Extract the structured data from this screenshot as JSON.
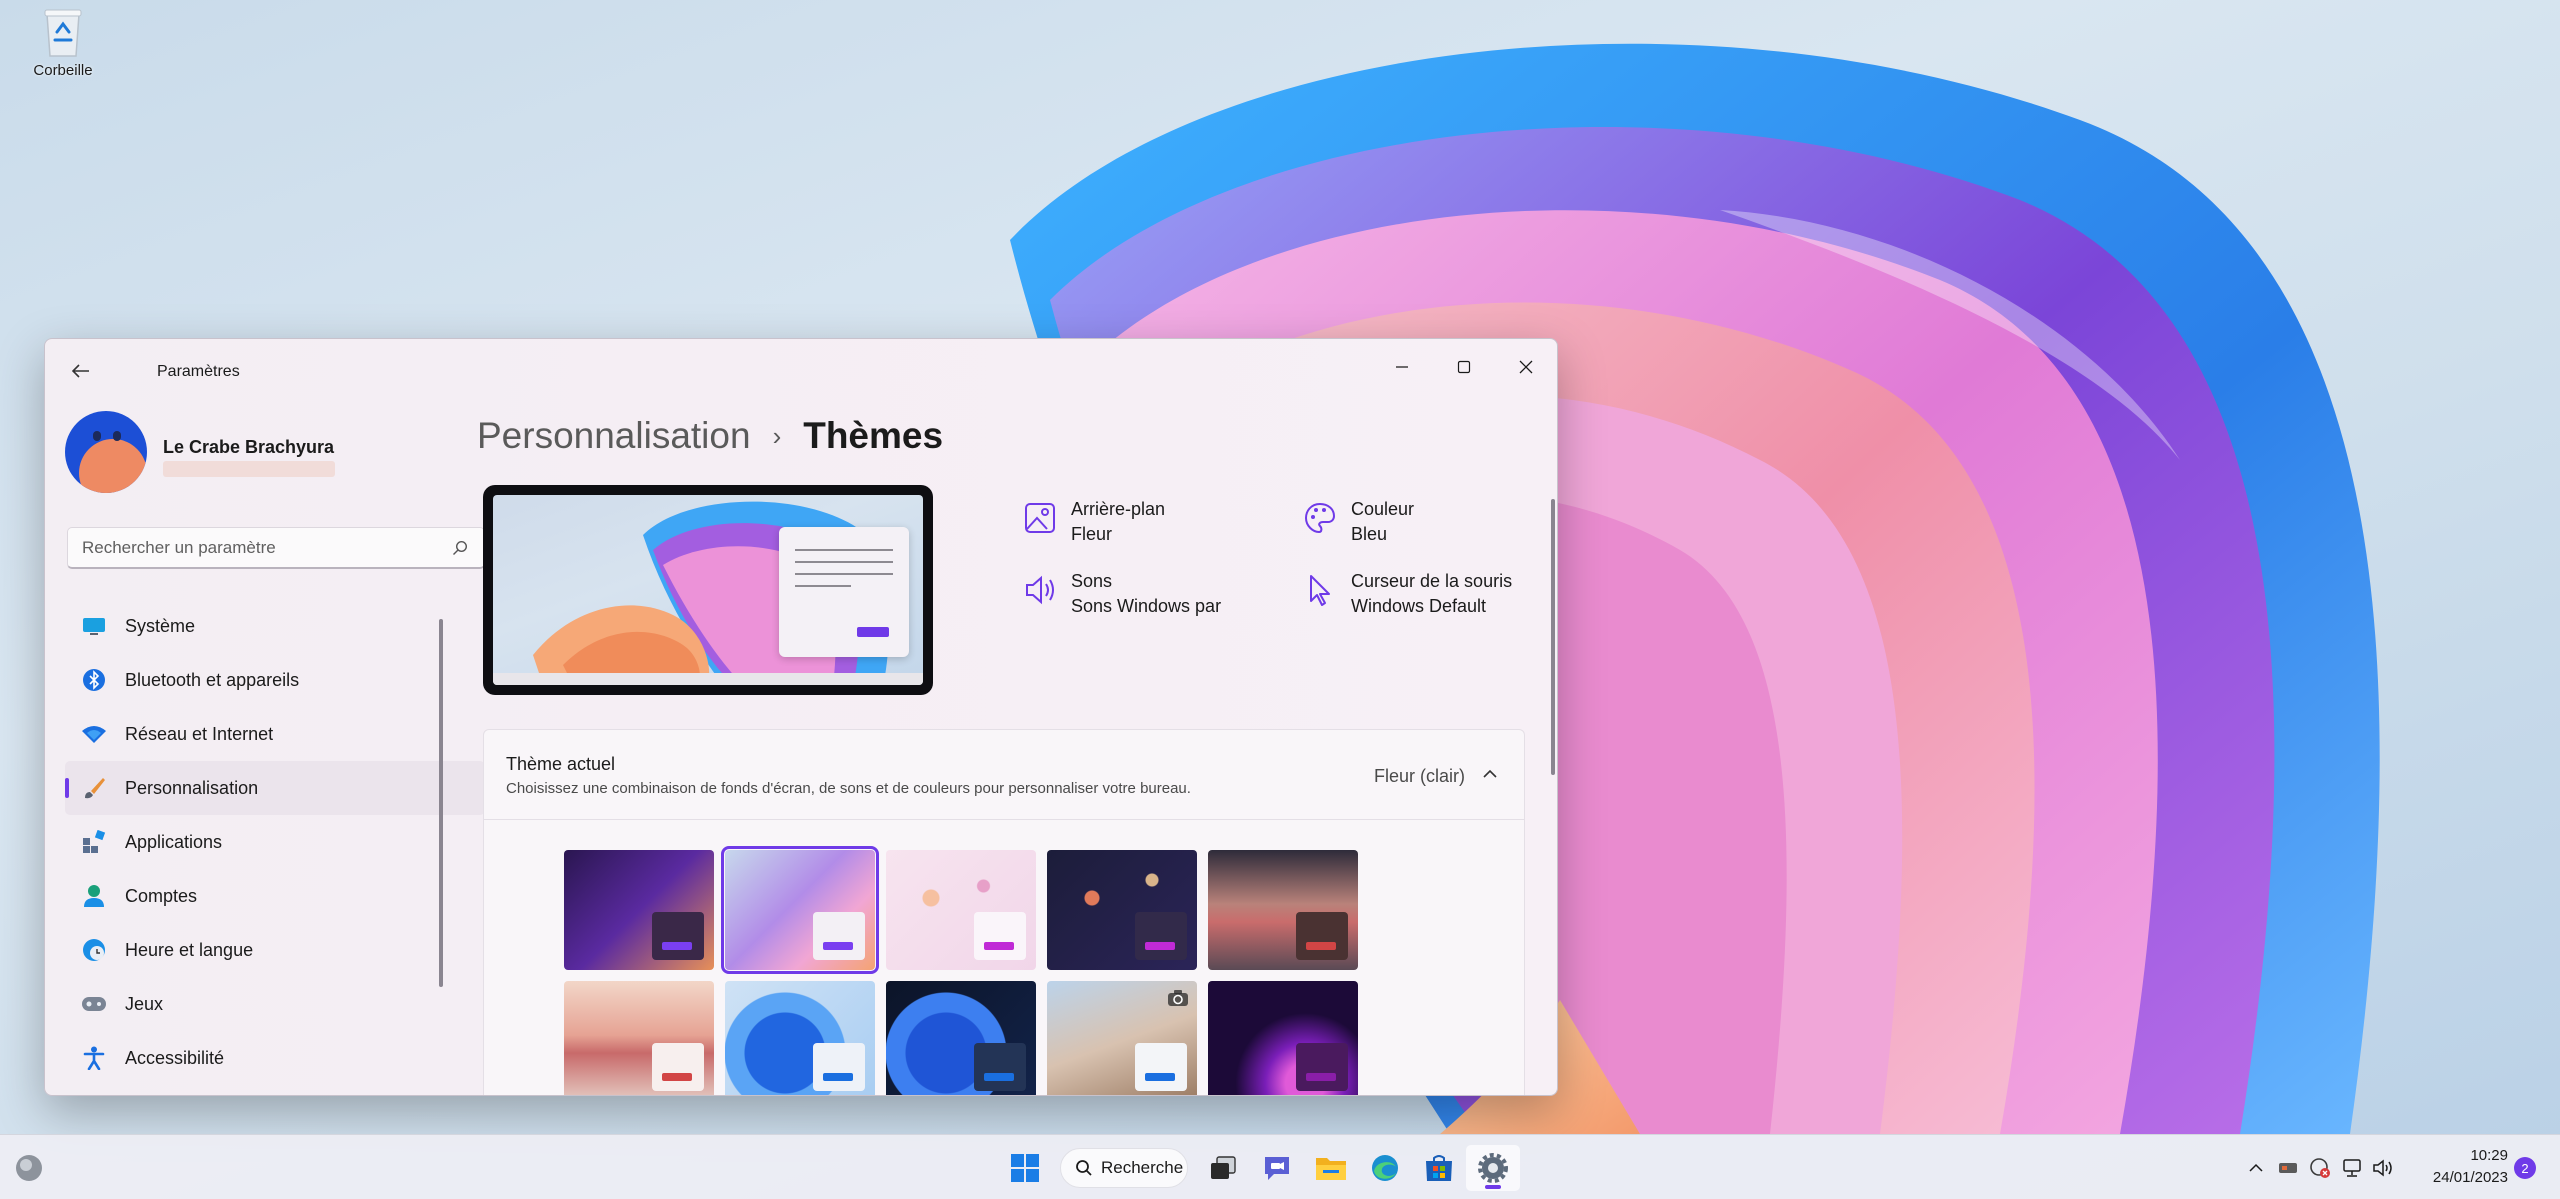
{
  "desktop": {
    "recycle_bin_label": "Corbeille"
  },
  "window": {
    "app_title": "Paramètres",
    "back_icon": "arrow-left-icon",
    "controls": {
      "minimize_icon": "minimize-icon",
      "maximize_icon": "maximize-icon",
      "close_icon": "close-icon"
    }
  },
  "profile": {
    "name": "Le Crabe Brachyura"
  },
  "search": {
    "placeholder": "Rechercher un paramètre"
  },
  "sidebar": {
    "items": [
      {
        "label": "Système",
        "icon": "monitor-icon",
        "active": false
      },
      {
        "label": "Bluetooth et appareils",
        "icon": "bluetooth-icon",
        "active": false
      },
      {
        "label": "Réseau et Internet",
        "icon": "wifi-icon",
        "active": false
      },
      {
        "label": "Personnalisation",
        "icon": "brush-icon",
        "active": true
      },
      {
        "label": "Applications",
        "icon": "apps-icon",
        "active": false
      },
      {
        "label": "Comptes",
        "icon": "person-icon",
        "active": false
      },
      {
        "label": "Heure et langue",
        "icon": "clock-globe-icon",
        "active": false
      },
      {
        "label": "Jeux",
        "icon": "gamepad-icon",
        "active": false
      },
      {
        "label": "Accessibilité",
        "icon": "accessibility-icon",
        "active": false
      }
    ]
  },
  "breadcrumb": {
    "parent": "Personnalisation",
    "separator": "›",
    "current": "Thèmes"
  },
  "theme_properties": [
    {
      "title": "Arrière-plan",
      "value": "Fleur",
      "icon": "image-icon"
    },
    {
      "title": "Couleur",
      "value": "Bleu",
      "icon": "palette-icon"
    },
    {
      "title": "Sons",
      "value": "Sons Windows par",
      "icon": "speaker-icon"
    },
    {
      "title": "Curseur de la souris",
      "value": "Windows Default",
      "icon": "cursor-icon"
    }
  ],
  "current_theme": {
    "title": "Thème actuel",
    "description": "Choisissez une combinaison de fonds d'écran, de sons et de couleurs pour personnaliser votre bureau.",
    "value": "Fleur (clair)",
    "chevron_icon": "chevron-up-icon"
  },
  "themes": [
    {
      "name": "bloom-dark",
      "selected": false,
      "accent": "#7a3ff0"
    },
    {
      "name": "bloom-light",
      "selected": true,
      "accent": "#7a3ff0"
    },
    {
      "name": "glow-light",
      "selected": false,
      "accent": "#c02ad6"
    },
    {
      "name": "planets-dark",
      "selected": false,
      "accent": "#c02ad6"
    },
    {
      "name": "dunes-dark",
      "selected": false,
      "accent": "#d24545"
    },
    {
      "name": "dunes-light",
      "selected": false,
      "accent": "#d24545"
    },
    {
      "name": "blue-bloom-light",
      "selected": false,
      "accent": "#1a6fe0"
    },
    {
      "name": "blue-bloom-dark",
      "selected": false,
      "accent": "#1a6fe0"
    },
    {
      "name": "spotlight",
      "selected": false,
      "accent": "#1a6fe0"
    },
    {
      "name": "captured-motion",
      "selected": false,
      "accent": "#8a1ea8"
    }
  ],
  "taskbar": {
    "search_label": "Recherche",
    "apps": [
      "start-icon",
      "search",
      "task-view-icon",
      "teams-chat-icon",
      "file-explorer-icon",
      "edge-icon",
      "store-icon",
      "settings-icon"
    ],
    "tray": [
      "chevron-up-icon",
      "usb-icon",
      "security-icon",
      "network-icon",
      "volume-icon"
    ],
    "time": "10:29",
    "date": "24/01/2023",
    "notification_count": "2"
  },
  "colors": {
    "accent": "#6f3ae8"
  }
}
